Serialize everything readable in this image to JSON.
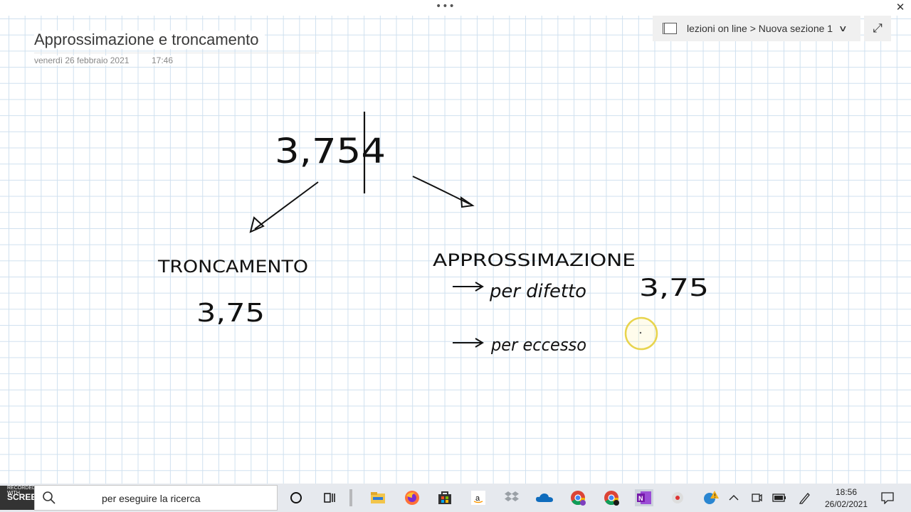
{
  "window": {
    "title_dots": "•••",
    "close_glyph": "✕"
  },
  "page": {
    "title": "Approssimazione e troncamento",
    "date": "venerdì 26 febbraio 2021",
    "time": "17:46"
  },
  "breadcrumb": {
    "text": "lezioni on line > Nuova sezione 1",
    "chevron": "∨",
    "expand_glyph": "⤢"
  },
  "ink": {
    "number": "3,754",
    "left_label": "TRONCAMENTO",
    "left_value": "3,75",
    "right_label": "APPROSSIMAZIONE",
    "by_defect": "per difetto",
    "by_defect_value": "3,75",
    "by_excess": "per eccesso"
  },
  "taskbar": {
    "search_placeholder": "per eseguire la ricerca",
    "recorded_with": "RECORDED WITH",
    "brand": "SCREENCAST",
    "time": "18:56",
    "date": "26/02/2021",
    "icons": [
      "cortana-icon",
      "task-view-icon",
      "file-explorer-icon",
      "firefox-icon",
      "store-icon",
      "amazon-icon",
      "dropbox-icon",
      "onedrive-icon",
      "chrome-icon",
      "chrome-profile-icon",
      "onenote-icon",
      "record-icon"
    ]
  },
  "colors": {
    "grid": "#cfe0ef",
    "ink": "#111111",
    "cursor_ring": "#e8d44d",
    "onenote": "#7719aa",
    "taskbar": "#e6e9ee"
  }
}
